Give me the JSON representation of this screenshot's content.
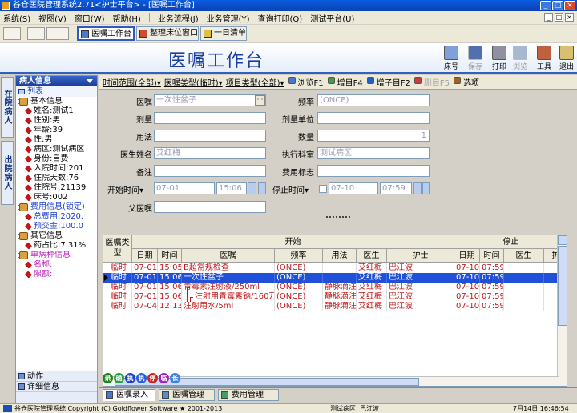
{
  "window": {
    "title": "谷仓医院管理系统2.71<护士平台> - [医嘱工作台]"
  },
  "menu": [
    "系统(S)",
    "视图(V)",
    "窗口(W)",
    "帮助(H)",
    "业务流程(J)",
    "业务管理(Y)",
    "查询打印(Q)",
    "测试平台(U)"
  ],
  "tabs": [
    {
      "label": "医嘱工作台",
      "active": true
    },
    {
      "label": "整理床位窗口",
      "active": false
    },
    {
      "label": "一日清单",
      "active": false
    }
  ],
  "header": {
    "title": "医嘱工作台"
  },
  "toolbar": [
    {
      "label": "床号",
      "icon": "person-icon",
      "disabled": false
    },
    {
      "label": "保存",
      "icon": "save-icon",
      "disabled": true
    },
    {
      "label": "打印",
      "icon": "printer-icon",
      "disabled": false
    },
    {
      "label": "浏览",
      "icon": "preview-icon",
      "disabled": true
    },
    {
      "label": "工具",
      "icon": "tools-icon",
      "disabled": false
    },
    {
      "label": "退出",
      "icon": "exit-icon",
      "disabled": false
    }
  ],
  "vtabs": [
    "在院病人",
    "出院病人"
  ],
  "left": {
    "header": "病人信息",
    "list_label": "列表",
    "tree": [
      {
        "t": "基本信息",
        "k": "g"
      },
      {
        "t": "姓名:测试1",
        "k": "c"
      },
      {
        "t": "性别:男",
        "k": "c"
      },
      {
        "t": "年龄:39",
        "k": "c"
      },
      {
        "t": "性:男",
        "k": "c"
      },
      {
        "t": "病区:测试病区",
        "k": "c"
      },
      {
        "t": "身份:自费",
        "k": "c"
      },
      {
        "t": "入院时间:201",
        "k": "c"
      },
      {
        "t": "住院天数:76",
        "k": "c"
      },
      {
        "t": "住院号:21139",
        "k": "c"
      },
      {
        "t": "床号:002",
        "k": "c"
      },
      {
        "t": "费用信息(锁定)",
        "k": "g",
        "color": "blue"
      },
      {
        "t": "总费用:2020.",
        "k": "c",
        "color": "blue"
      },
      {
        "t": "预交金:100.0",
        "k": "c",
        "color": "blue"
      },
      {
        "t": "其它信息",
        "k": "g"
      },
      {
        "t": "药占比:7.31%",
        "k": "c"
      },
      {
        "t": "单病种信息",
        "k": "g",
        "color": "mag"
      },
      {
        "t": "名称:",
        "k": "c",
        "color": "mag"
      },
      {
        "t": "限额:",
        "k": "c",
        "color": "mag"
      }
    ],
    "footer": [
      "动作",
      "详细信息"
    ]
  },
  "filters": [
    {
      "label": "时间范围(全部)",
      "type": "dd"
    },
    {
      "label": "医嘱类型(临时)",
      "type": "dd"
    },
    {
      "label": "项目类型(全部)",
      "type": "dd"
    },
    {
      "label": "浏览F1",
      "type": "btn",
      "icon": "browse-icon"
    },
    {
      "label": "增目F4",
      "type": "btn",
      "icon": "add-item-icon"
    },
    {
      "label": "增子目F2",
      "type": "btn",
      "icon": "add-subitem-icon"
    },
    {
      "label": "删目F5",
      "type": "btn",
      "icon": "delete-item-icon",
      "disabled": true
    },
    {
      "label": "选项",
      "type": "btn",
      "icon": "options-icon"
    }
  ],
  "form": {
    "order_label": "医嘱",
    "order_value": "一次性盆子",
    "freq_label": "频率",
    "freq_value": "(ONCE)",
    "dose_label": "剂量",
    "dose_unit_label": "剂量单位",
    "usage_label": "用法",
    "qty_label": "数量",
    "qty_value": "1",
    "doctor_label": "医生姓名",
    "doctor_value": "艾红梅",
    "dept_label": "执行科室",
    "dept_value": "测试病区",
    "note_label": "备注",
    "fee_label": "费用标志",
    "start_label": "开始时间",
    "start_date": "07-01",
    "start_time": "15:06",
    "stop_label": "停止时间",
    "stop_date": "07-10",
    "stop_time": "07:59",
    "parent_label": "父医嘱"
  },
  "grid": {
    "group_start": "开始",
    "group_stop": "停止",
    "type_header": "医嘱类型",
    "headers": [
      "日期",
      "时间",
      "医嘱",
      "频率",
      "用法",
      "医生",
      "护士",
      "日期",
      "时间",
      "医生",
      "护"
    ],
    "rows": [
      {
        "c": [
          "临时",
          "07-01",
          "15:05",
          "B超常规检查",
          "(ONCE)",
          "",
          "艾红梅",
          "巴江波",
          "07-10",
          "07:59",
          ""
        ],
        "sel": false,
        "mark": false
      },
      {
        "c": [
          "临时",
          "07-01",
          "15:06",
          "一次性盆子",
          "(ONCE)",
          "",
          "艾红梅",
          "巴江波",
          "07-10",
          "07:59",
          ""
        ],
        "sel": true,
        "mark": true
      },
      {
        "c": [
          "临时",
          "07-01",
          "15:06",
          "青霉素注射液/250ml",
          "(ONCE)",
          "静脉滴注",
          "艾红梅",
          "巴江波",
          "07-10",
          "07:59",
          ""
        ],
        "sel": false,
        "mark": false
      },
      {
        "c": [
          "临时",
          "07-01",
          "15:06",
          "注射用青霉素钠/160万IU",
          "(ONCE)",
          "静脉滴注",
          "艾红梅",
          "巴江波",
          "07-10",
          "07:59",
          ""
        ],
        "sel": false,
        "mark": false,
        "child": true
      },
      {
        "c": [
          "临时",
          "07-04",
          "12:13",
          "注射用水/5ml",
          "(ONCE)",
          "静脉滴注",
          "艾红梅",
          "巴江波",
          "07-10",
          "07:59",
          ""
        ],
        "sel": false,
        "mark": false
      }
    ]
  },
  "status_icons": [
    {
      "t": "录",
      "color": "#208020"
    },
    {
      "t": "确",
      "color": "#20A040"
    },
    {
      "t": "执",
      "color": "#2040C0"
    },
    {
      "t": "执",
      "color": "#2060E0"
    },
    {
      "t": "停",
      "color": "#D02020"
    },
    {
      "t": "临",
      "color": "#A020C0"
    },
    {
      "t": "长",
      "color": "#4080E0"
    }
  ],
  "bottom_tabs": [
    {
      "label": "医嘱录入",
      "active": true
    },
    {
      "label": "医嘱管理",
      "active": false
    },
    {
      "label": "费用管理",
      "active": false
    }
  ],
  "status": {
    "copyright": "谷仓医院管理系统 Copyright (C) Goldflower Software ★ 2001-2013",
    "ward": "测试病区, 巴江波",
    "time": "7月14日  16:46:54"
  }
}
